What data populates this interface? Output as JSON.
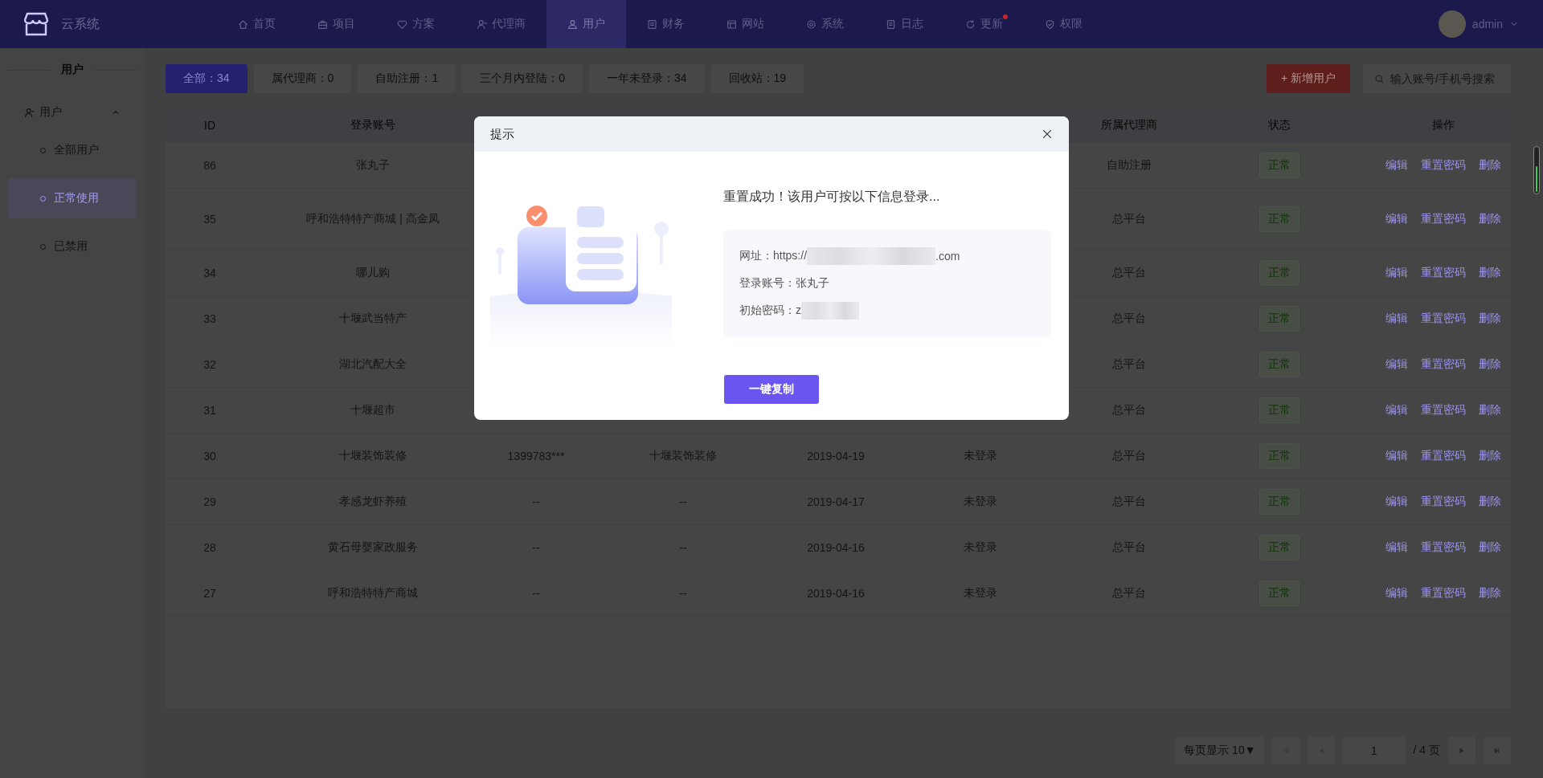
{
  "app": {
    "name": "云系统"
  },
  "nav": [
    {
      "label": "首页",
      "selected": false,
      "badge": false
    },
    {
      "label": "项目",
      "selected": false,
      "badge": false
    },
    {
      "label": "方案",
      "selected": false,
      "badge": false
    },
    {
      "label": "代理商",
      "selected": false,
      "badge": false
    },
    {
      "label": "用户",
      "selected": true,
      "badge": false
    },
    {
      "label": "财务",
      "selected": false,
      "badge": false
    },
    {
      "label": "网站",
      "selected": false,
      "badge": false
    },
    {
      "label": "系统",
      "selected": false,
      "badge": false
    },
    {
      "label": "日志",
      "selected": false,
      "badge": false
    },
    {
      "label": "更新",
      "selected": false,
      "badge": true
    },
    {
      "label": "权限",
      "selected": false,
      "badge": false
    }
  ],
  "user": {
    "name": "admin"
  },
  "sidebar": {
    "title": "用户",
    "group": {
      "label": "用户",
      "expanded": true
    },
    "items": [
      {
        "label": "全部用户",
        "selected": false
      },
      {
        "label": "正常使用",
        "selected": true
      },
      {
        "label": "已禁用",
        "selected": false
      }
    ]
  },
  "filters": [
    {
      "label": "全部：34",
      "selected": true
    },
    {
      "label": "属代理商：0",
      "selected": false
    },
    {
      "label": "自助注册：1",
      "selected": false
    },
    {
      "label": "三个月内登陆：0",
      "selected": false
    },
    {
      "label": "一年未登录：34",
      "selected": false
    },
    {
      "label": "回收站：19",
      "selected": false
    }
  ],
  "add_button": "+ 新增用户",
  "search": {
    "placeholder": "输入账号/手机号搜索"
  },
  "table": {
    "columns": [
      "ID",
      "登录账号",
      null,
      null,
      null,
      null,
      "所属代理商",
      "状态",
      "操作"
    ],
    "rows": [
      {
        "cells": [
          "86",
          "张丸子",
          null,
          null,
          null,
          null,
          "自助注册"
        ],
        "status": "正常",
        "actions": [
          "编辑",
          "重置密码",
          "删除"
        ]
      },
      {
        "cells": [
          "35",
          "呼和浩特特产商城 | 高金凤",
          null,
          null,
          null,
          null,
          "总平台"
        ],
        "status": "正常",
        "actions": [
          "编辑",
          "重置密码",
          "删除"
        ]
      },
      {
        "cells": [
          "34",
          "哪儿购",
          null,
          null,
          null,
          null,
          "总平台"
        ],
        "status": "正常",
        "actions": [
          "编辑",
          "重置密码",
          "删除"
        ]
      },
      {
        "cells": [
          "33",
          "十堰武当特产",
          null,
          null,
          null,
          null,
          "总平台"
        ],
        "status": "正常",
        "actions": [
          "编辑",
          "重置密码",
          "删除"
        ]
      },
      {
        "cells": [
          "32",
          "湖北汽配大全",
          null,
          null,
          null,
          null,
          "总平台"
        ],
        "status": "正常",
        "actions": [
          "编辑",
          "重置密码",
          "删除"
        ]
      },
      {
        "cells": [
          "31",
          "十堰超市",
          null,
          null,
          null,
          null,
          "总平台"
        ],
        "status": "正常",
        "actions": [
          "编辑",
          "重置密码",
          "删除"
        ]
      },
      {
        "cells": [
          "30",
          "十堰装饰装修",
          "1399783***",
          "十堰装饰装修",
          "2019-04-19",
          "未登录",
          "总平台"
        ],
        "status": "正常",
        "actions": [
          "编辑",
          "重置密码",
          "删除"
        ]
      },
      {
        "cells": [
          "29",
          "孝感龙虾养殖",
          "--",
          "--",
          "2019-04-17",
          "未登录",
          "总平台"
        ],
        "status": "正常",
        "actions": [
          "编辑",
          "重置密码",
          "删除"
        ]
      },
      {
        "cells": [
          "28",
          "黄石母婴家政服务",
          "--",
          "--",
          "2019-04-16",
          "未登录",
          "总平台"
        ],
        "status": "正常",
        "actions": [
          "编辑",
          "重置密码",
          "删除"
        ]
      },
      {
        "cells": [
          "27",
          "呼和浩特特产商城",
          "--",
          "--",
          "2019-04-16",
          "未登录",
          "总平台"
        ],
        "status": "正常",
        "actions": [
          "编辑",
          "重置密码",
          "删除"
        ]
      }
    ]
  },
  "pagination": {
    "page_size": "每页显示 10▼",
    "page": "1",
    "total": "/ 4 页"
  },
  "dialog": {
    "title": "提示",
    "message": "重置成功！该用户可按以下信息登录...",
    "lines": [
      {
        "label": "网址：",
        "value": "https://",
        "redacted": true,
        "suffix": ".com"
      },
      {
        "label": "登录账号：",
        "value": "张丸子",
        "redacted": false
      },
      {
        "label": "初始密码：",
        "value": "z",
        "redacted": true
      }
    ],
    "button": "一键复制"
  }
}
